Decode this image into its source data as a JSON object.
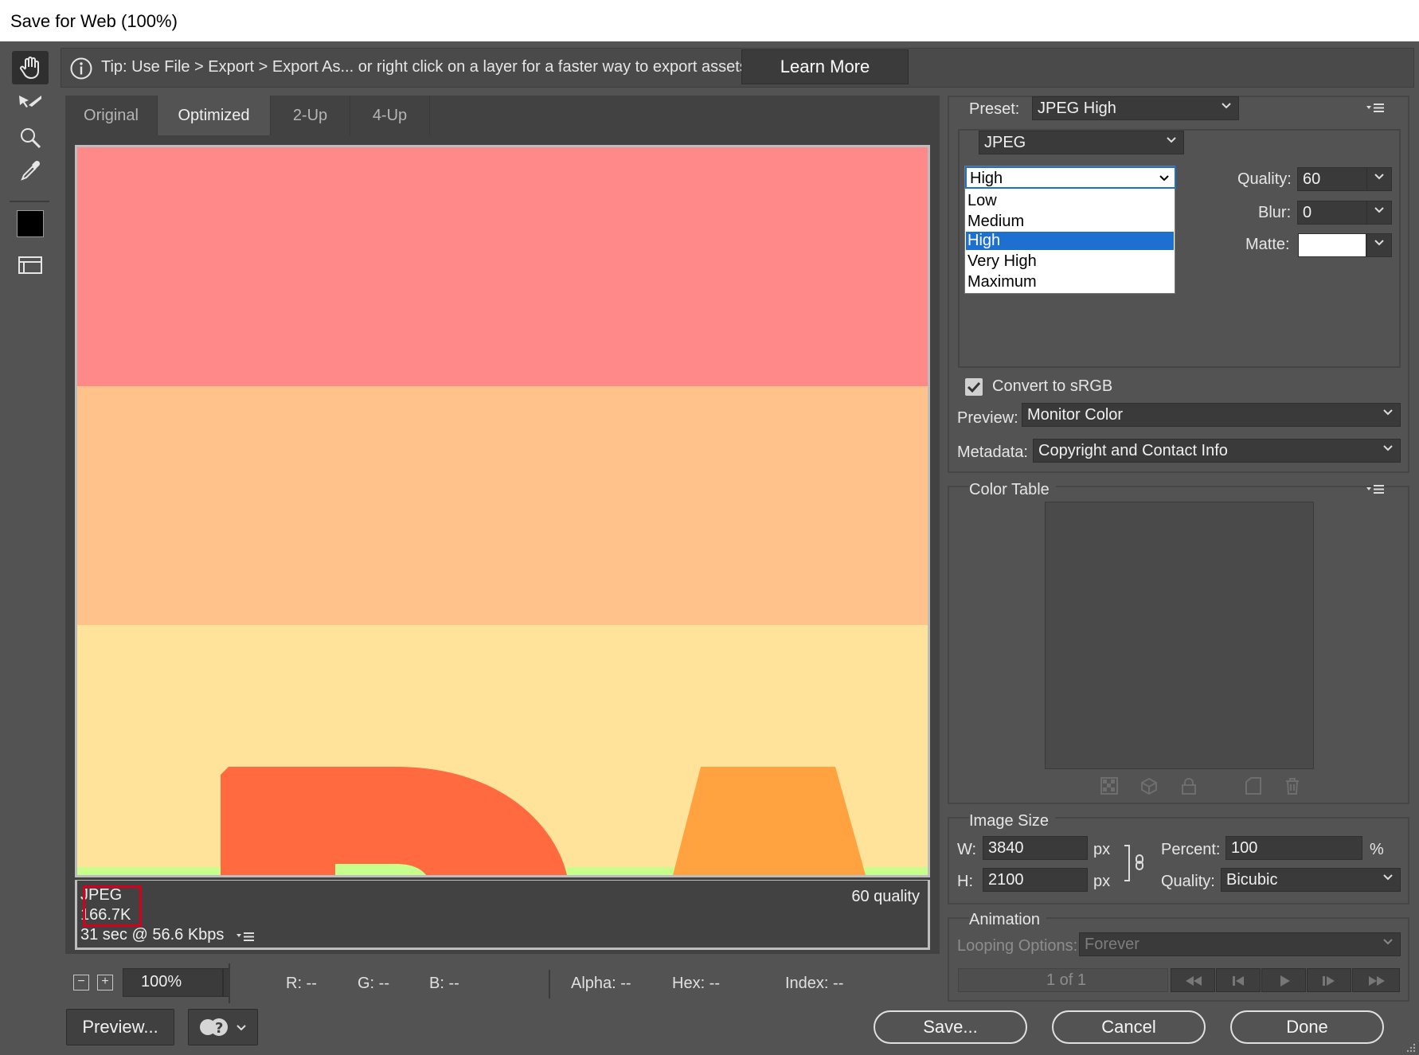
{
  "window": {
    "title": "Save for Web (100%)"
  },
  "tools": {
    "hand": "hand-icon",
    "slice_select": "slice-select-icon",
    "zoom": "zoom-icon",
    "eyedropper": "eyedropper-icon",
    "color_swatch": "#000000",
    "toggle_slices": "toggle-slices-icon"
  },
  "tip": {
    "text": "Tip: Use File > Export > Export As...  or right click on a layer for a faster way to export assets",
    "learn_more": "Learn More"
  },
  "tabs": [
    {
      "label": "Original"
    },
    {
      "label": "Optimized",
      "active": true
    },
    {
      "label": "2-Up"
    },
    {
      "label": "4-Up"
    }
  ],
  "image_info": {
    "format": "JPEG",
    "size": "166.7K",
    "download": "31 sec @ 56.6 Kbps",
    "quality": "60 quality"
  },
  "zoom": {
    "value": "100%",
    "minus": "−",
    "plus": "+"
  },
  "pixel_info": {
    "r": "R: --",
    "g": "G: --",
    "b": "B: --",
    "alpha": "Alpha: --",
    "hex": "Hex: --",
    "index": "Index: --"
  },
  "bottom": {
    "preview": "Preview...",
    "save": "Save...",
    "cancel": "Cancel",
    "done": "Done"
  },
  "settings": {
    "preset_label": "Preset:",
    "preset_value": "JPEG High",
    "format_value": "JPEG",
    "quality_level": "High",
    "quality_levels": [
      "Low",
      "Medium",
      "High",
      "Very High",
      "Maximum"
    ],
    "quality_label": "Quality:",
    "quality_value": "60",
    "blur_label": "Blur:",
    "blur_value": "0",
    "matte_label": "Matte:",
    "matte_color": "#ffffff",
    "convert_srgb": "Convert to sRGB",
    "convert_checked": true,
    "preview_label": "Preview:",
    "preview_value": "Monitor Color",
    "metadata_label": "Metadata:",
    "metadata_value": "Copyright and Contact Info"
  },
  "color_table": {
    "title": "Color Table"
  },
  "image_size": {
    "title": "Image Size",
    "w_label": "W:",
    "w_value": "3840",
    "h_label": "H:",
    "h_value": "2100",
    "unit": "px",
    "percent_label": "Percent:",
    "percent_value": "100",
    "percent_unit": "%",
    "quality_label": "Quality:",
    "quality_value": "Bicubic"
  },
  "animation": {
    "title": "Animation",
    "looping_label": "Looping Options:",
    "looping_value": "Forever",
    "frame": "1 of 1"
  },
  "colors": {
    "accent": "#1e70d0",
    "band_top": "#ff8888",
    "band_middle": "#ffc28a",
    "band_bottom": "#ffe39b",
    "letter_red": "#ff6a40",
    "letter_orange": "#ffa23f",
    "green_strip": "#c8ff8c",
    "highlight_box": "#d6001c"
  }
}
